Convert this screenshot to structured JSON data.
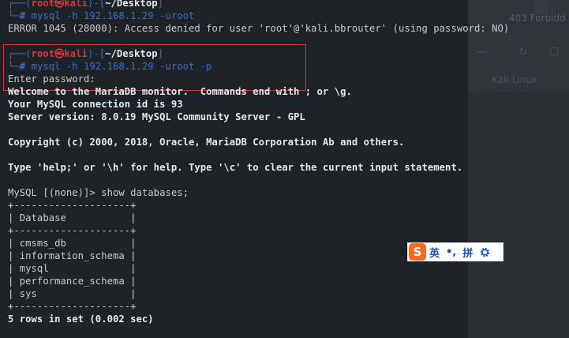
{
  "background_window": {
    "tab_text": "403 Forbidd",
    "bookmark_text": "Kali Linux"
  },
  "prompt": {
    "user": "root",
    "at_symbol": "㉿",
    "host": "kali",
    "cwd": "~/Desktop",
    "hash": "#"
  },
  "lines": {
    "l1_cmd": "mysql -h 192.168.1.29 -uroot",
    "l2_error": "ERROR 1045 (28000): Access denied for user 'root'@'kali.bbrouter' (using password: NO)",
    "l5_cmd": "mysql -h 192.168.1.29 -uroot -p",
    "l6_enter_password": "Enter password:",
    "l7_welcome": "Welcome to the MariaDB monitor.  Commands end with ; or \\g.",
    "l8_conn_id": "Your MySQL connection id is 93",
    "l9_version": "Server version: 8.0.19 MySQL Community Server - GPL",
    "l11_copyright": "Copyright (c) 2000, 2018, Oracle, MariaDB Corporation Ab and others.",
    "l13_help": "Type 'help;' or '\\h' for help. Type '\\c' to clear the current input statement.",
    "l15_query": "MySQL [(none)]> show databases;",
    "l16_border": "+--------------------+",
    "l17_header": "| Database           |",
    "l18_border": "+--------------------+",
    "rows": [
      "| cmsms_db           |",
      "| information_schema |",
      "| mysql              |",
      "| performance_schema |",
      "| sys                |"
    ],
    "l24_border": "+--------------------+",
    "l25_result": "5 rows in set (0.002 sec)"
  },
  "ime_toolbar": {
    "logo": "S",
    "lang": "英",
    "punct": "•,",
    "mode": "拼"
  },
  "colors": {
    "terminal_bg": "#1d2229",
    "prompt_frame": "#2f6fd4",
    "prompt_user": "#e0343b",
    "highlight_box": "#d8343a",
    "ime_logo": "#f36b1c"
  }
}
